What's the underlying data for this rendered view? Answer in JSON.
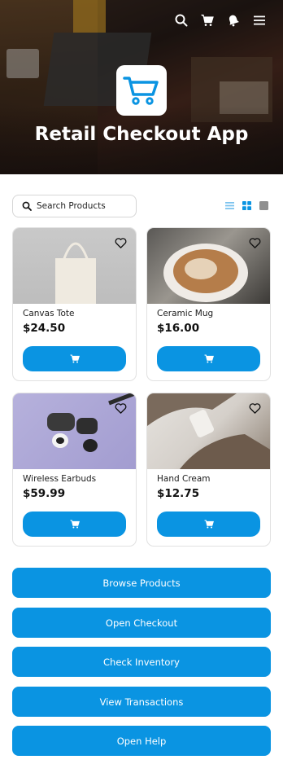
{
  "header": {
    "app_title": "Retail Checkout App",
    "icons": [
      "search-icon",
      "cart-icon",
      "notification-bell-icon",
      "menu-icon"
    ]
  },
  "search": {
    "placeholder": "Search Products"
  },
  "view_options": [
    "list-view-icon",
    "grid-view-icon",
    "single-view-icon"
  ],
  "products": [
    {
      "name": "Canvas Tote",
      "price": "$24.50"
    },
    {
      "name": "Ceramic Mug",
      "price": "$16.00"
    },
    {
      "name": "Wireless Earbuds",
      "price": "$59.99"
    },
    {
      "name": "Hand Cream",
      "price": "$12.75"
    }
  ],
  "actions": [
    {
      "label": "Browse Products"
    },
    {
      "label": "Open Checkout"
    },
    {
      "label": "Check Inventory"
    },
    {
      "label": "View Transactions"
    },
    {
      "label": "Open Help"
    }
  ],
  "colors": {
    "accent": "#0a94e2",
    "border": "#e1e1e1"
  }
}
